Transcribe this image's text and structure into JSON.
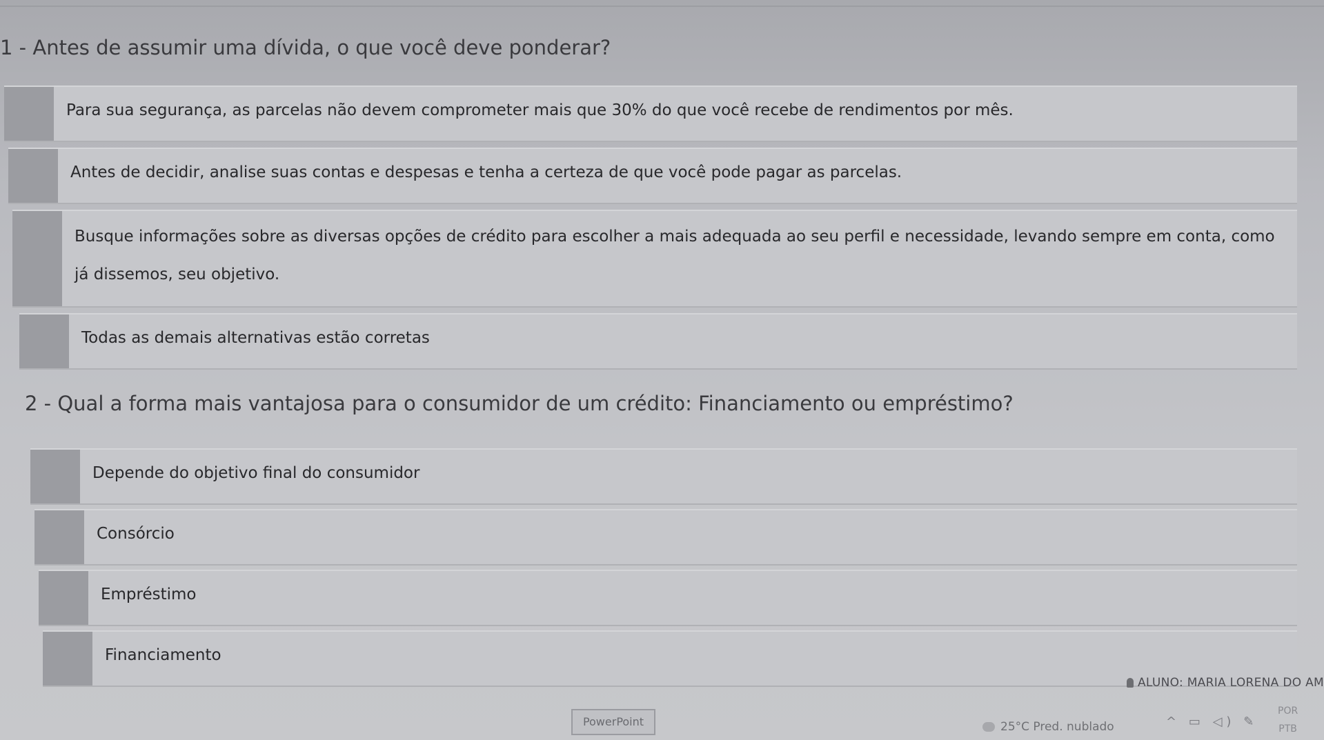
{
  "questions": [
    {
      "title": "1 - Antes de assumir uma dívida, o que você deve ponderar?",
      "options": [
        "Para sua segurança, as parcelas não devem comprometer mais que 30% do que você recebe de rendimentos por mês.",
        "Antes de decidir, analise suas contas e despesas e tenha a certeza de que você pode pagar as parcelas.",
        "Busque informações sobre as diversas opções de crédito para escolher a mais adequada ao seu perfil e necessidade, levando sempre em conta, como já dissemos, seu objetivo.",
        "Todas as demais alternativas estão corretas"
      ]
    },
    {
      "title": "2 - Qual a forma mais vantajosa para o consumidor de um crédito: Financiamento ou empréstimo?",
      "options": [
        "Depende do objetivo final do consumidor",
        "Consórcio",
        "Empréstimo",
        "Financiamento"
      ]
    }
  ],
  "footer": {
    "user_label": "ALUNO: MARIA LORENA DO AM",
    "user_icon": "user-icon"
  },
  "taskbar": {
    "app_button": "PowerPoint",
    "weather": "25°C  Pred. nublado",
    "weather_icon": "cloud-icon",
    "tray_icons": [
      "chevron-up-icon",
      "network-icon",
      "volume-icon",
      "pen-icon"
    ],
    "lang_top": "POR",
    "lang_bottom": "PTB"
  }
}
